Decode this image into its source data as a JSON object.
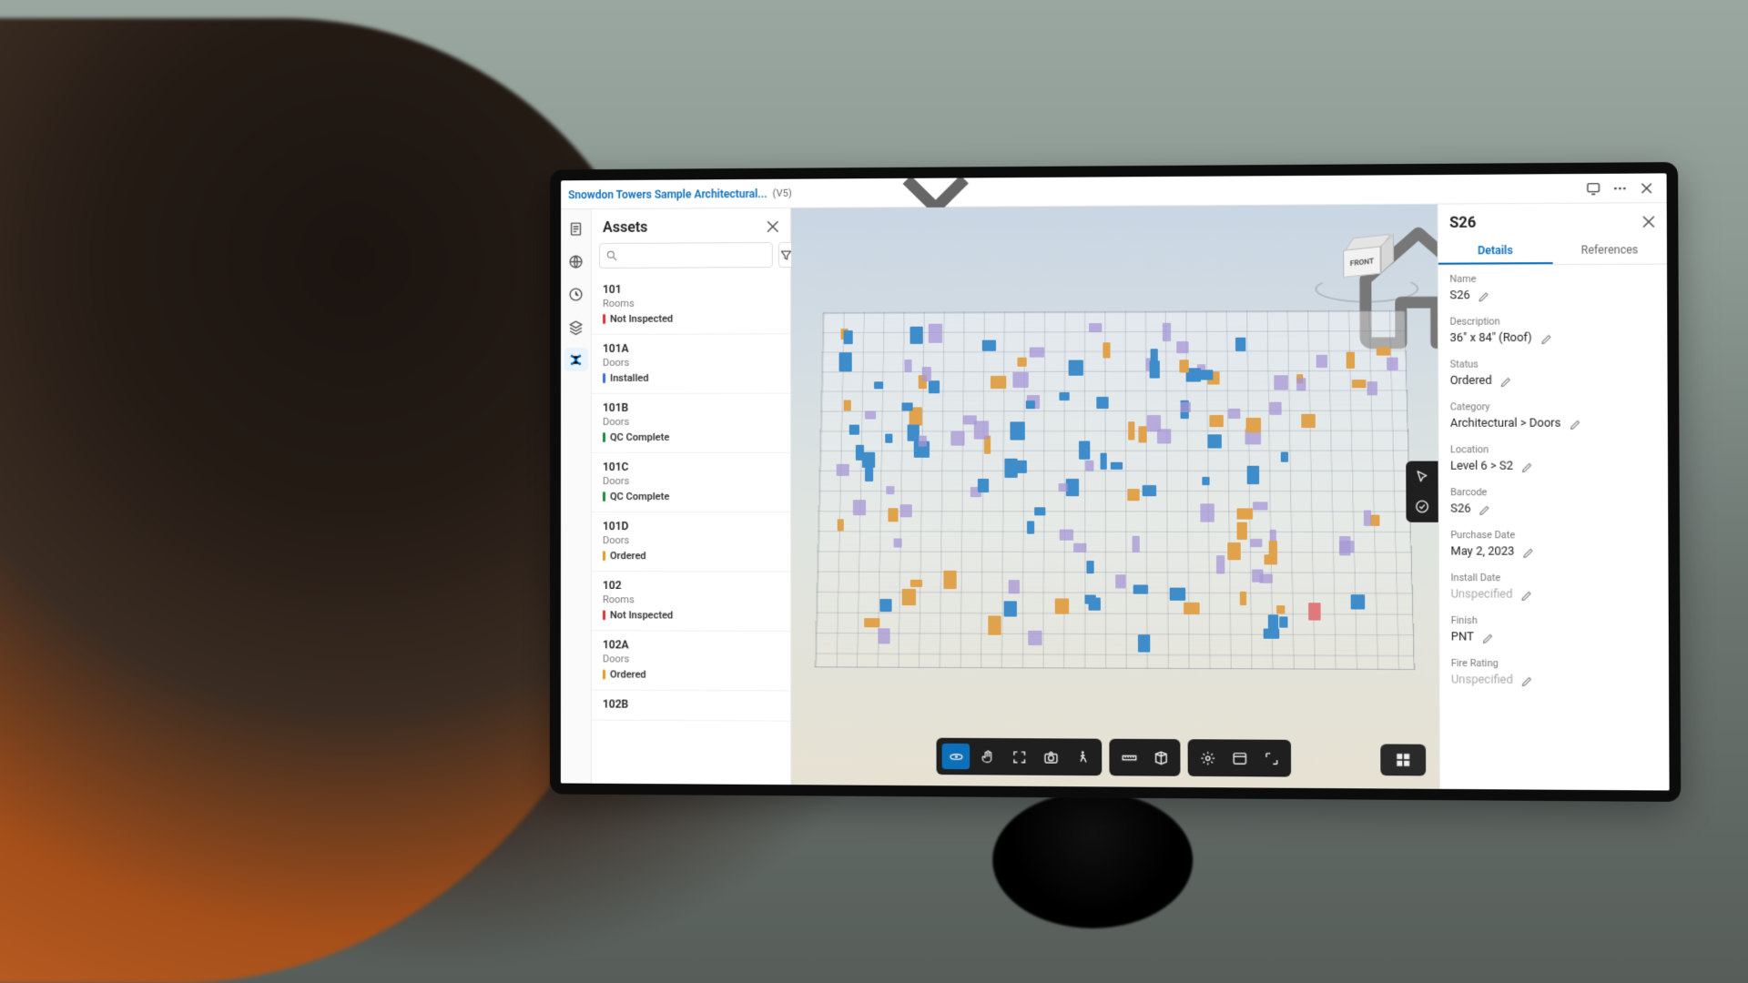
{
  "topbar": {
    "doc_title": "Snowdon Towers Sample Architectural...",
    "version": "(V5)"
  },
  "assets": {
    "title": "Assets",
    "search_placeholder": "",
    "items": [
      {
        "id": "101",
        "category": "Rooms",
        "status": "Not Inspected",
        "status_class": "st-not-inspected"
      },
      {
        "id": "101A",
        "category": "Doors",
        "status": "Installed",
        "status_class": "st-installed"
      },
      {
        "id": "101B",
        "category": "Doors",
        "status": "QC Complete",
        "status_class": "st-qc-complete"
      },
      {
        "id": "101C",
        "category": "Doors",
        "status": "QC Complete",
        "status_class": "st-qc-complete"
      },
      {
        "id": "101D",
        "category": "Doors",
        "status": "Ordered",
        "status_class": "st-ordered"
      },
      {
        "id": "102",
        "category": "Rooms",
        "status": "Not Inspected",
        "status_class": "st-not-inspected"
      },
      {
        "id": "102A",
        "category": "Doors",
        "status": "Ordered",
        "status_class": "st-ordered"
      },
      {
        "id": "102B",
        "category": "",
        "status": "",
        "status_class": ""
      }
    ]
  },
  "viewcube": {
    "front": "FRONT"
  },
  "details": {
    "title": "S26",
    "tabs": {
      "details": "Details",
      "references": "References"
    },
    "props": [
      {
        "label": "Name",
        "value": "S26",
        "placeholder": false
      },
      {
        "label": "Description",
        "value": "36\" x 84\" (Roof)",
        "placeholder": false
      },
      {
        "label": "Status",
        "value": "Ordered",
        "placeholder": false
      },
      {
        "label": "Category",
        "value": "Architectural > Doors",
        "placeholder": false
      },
      {
        "label": "Location",
        "value": "Level 6 > S2",
        "placeholder": false
      },
      {
        "label": "Barcode",
        "value": "S26",
        "placeholder": false
      },
      {
        "label": "Purchase Date",
        "value": "May 2, 2023",
        "placeholder": false
      },
      {
        "label": "Install Date",
        "value": "Unspecified",
        "placeholder": true
      },
      {
        "label": "Finish",
        "value": "PNT",
        "placeholder": false
      },
      {
        "label": "Fire Rating",
        "value": "Unspecified",
        "placeholder": true
      }
    ]
  },
  "colors": {
    "accent": "#0b6fba",
    "status_not_inspected": "#d33",
    "status_installed": "#3a6fd8",
    "status_qc_complete": "#1f8a3b",
    "status_ordered": "#e59a1f"
  }
}
